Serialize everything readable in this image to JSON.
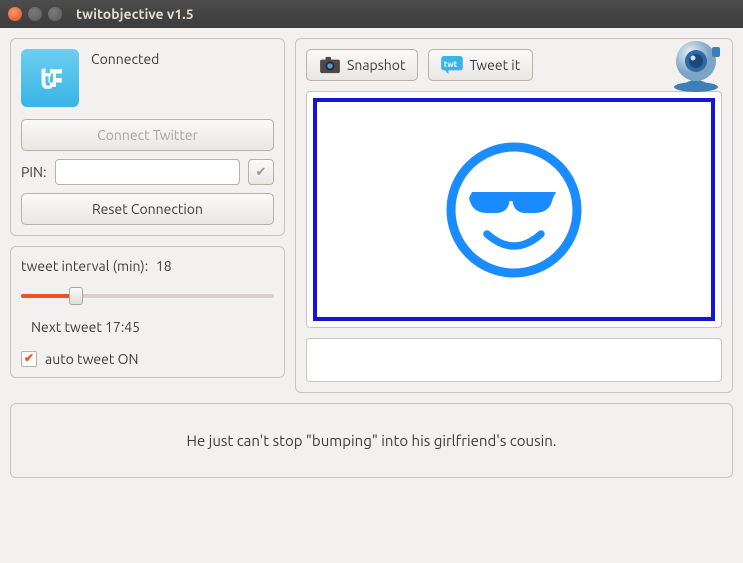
{
  "window": {
    "title": "twitobjective v1.5"
  },
  "connection": {
    "status": "Connected",
    "connect_btn": "Connect Twitter",
    "pin_label": "PIN:",
    "pin_value": "",
    "reset_btn": "Reset Connection"
  },
  "interval": {
    "label": "tweet interval (min):",
    "value": "18",
    "next_tweet": "Next tweet 17:45",
    "auto_label": "auto tweet ON",
    "auto_checked": true
  },
  "toolbar": {
    "snapshot": "Snapshot",
    "tweet_it": "Tweet it"
  },
  "caption": "",
  "footer": {
    "text": "He just can't stop \"bumping\" into his girlfriend's cousin."
  }
}
